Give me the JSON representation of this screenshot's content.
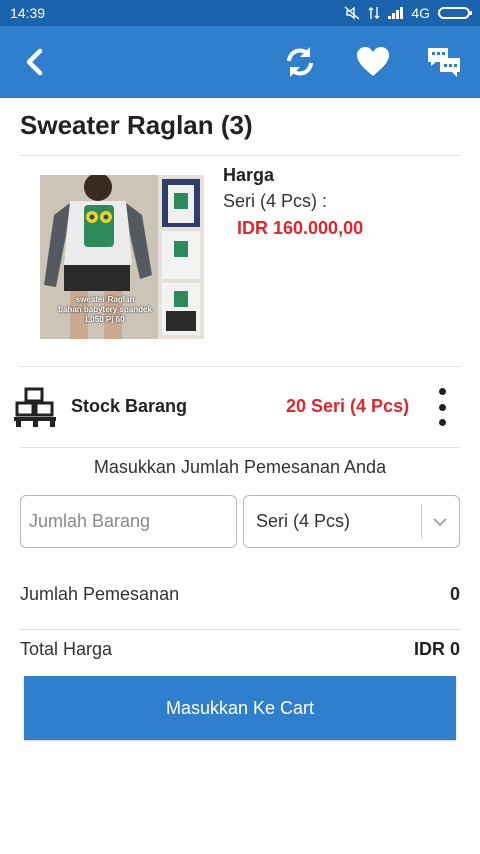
{
  "status_bar": {
    "time": "14:39",
    "network": "4G"
  },
  "app_bar": {
    "back_icon": "chevron-left-icon",
    "actions": [
      "refresh-icon",
      "heart-icon",
      "chat-icon"
    ]
  },
  "product": {
    "title": "Sweater Raglan (3)",
    "image_caption": [
      "sweater Raglan",
      "bahan babytery spandek",
      "L050 Pj 60"
    ],
    "price_label": "Harga",
    "unit_label": "Seri (4 Pcs) :",
    "price_value": "IDR 160.000,00"
  },
  "stock": {
    "label": "Stock Barang",
    "value": "20 Seri (4 Pcs)"
  },
  "order": {
    "prompt": "Masukkan Jumlah Pemesanan Anda",
    "quantity_placeholder": "Jumlah Barang",
    "unit_selected": "Seri (4 Pcs)",
    "quantity_label": "Jumlah Pemesanan",
    "quantity_value": "0",
    "total_label": "Total Harga",
    "total_value": "IDR 0"
  },
  "cart_button_label": "Masukkan Ke Cart",
  "colors": {
    "status_bar": "#1c63ad",
    "app_bar": "#2f7fcd",
    "accent_red": "#e0262c",
    "button": "#2f7fcd"
  }
}
